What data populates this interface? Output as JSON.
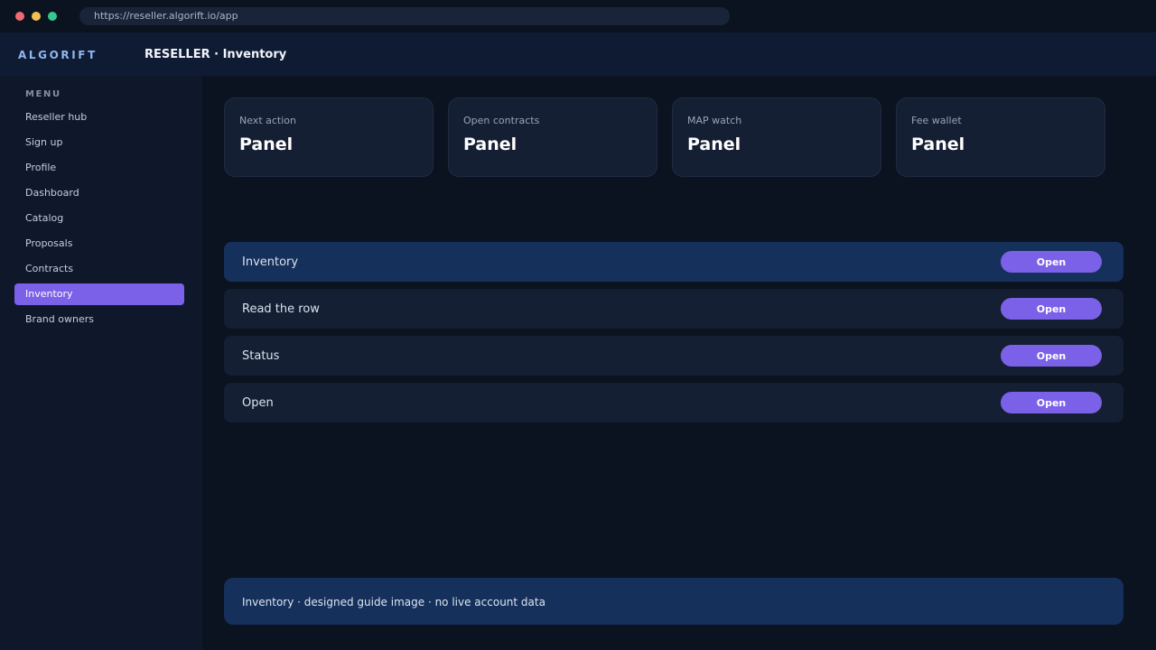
{
  "browser": {
    "url": "https://reseller.algorift.io/app"
  },
  "header": {
    "brand": "ALGORIFT",
    "title": "RESELLER · Inventory"
  },
  "sidebar": {
    "menu_label": "MENU",
    "items": [
      {
        "label": "Reseller hub",
        "active": false
      },
      {
        "label": "Sign up",
        "active": false
      },
      {
        "label": "Profile",
        "active": false
      },
      {
        "label": "Dashboard",
        "active": false
      },
      {
        "label": "Catalog",
        "active": false
      },
      {
        "label": "Proposals",
        "active": false
      },
      {
        "label": "Contracts",
        "active": false
      },
      {
        "label": "Inventory",
        "active": true
      },
      {
        "label": "Brand owners",
        "active": false
      }
    ]
  },
  "cards": [
    {
      "label": "Next action",
      "value": "Panel"
    },
    {
      "label": "Open contracts",
      "value": "Panel"
    },
    {
      "label": "MAP watch",
      "value": "Panel"
    },
    {
      "label": "Fee wallet",
      "value": "Panel"
    }
  ],
  "rows": [
    {
      "label": "Inventory",
      "button": "Open",
      "highlighted": true
    },
    {
      "label": "Read the row",
      "button": "Open",
      "highlighted": false
    },
    {
      "label": "Status",
      "button": "Open",
      "highlighted": false
    },
    {
      "label": "Open",
      "button": "Open",
      "highlighted": false
    }
  ],
  "footer": {
    "note": "Inventory · designed guide image · no live account data"
  },
  "colors": {
    "accent": "#7b61e8",
    "background": "#0b1220",
    "sidebar": "#0f172a",
    "highlight": "#15305a"
  }
}
